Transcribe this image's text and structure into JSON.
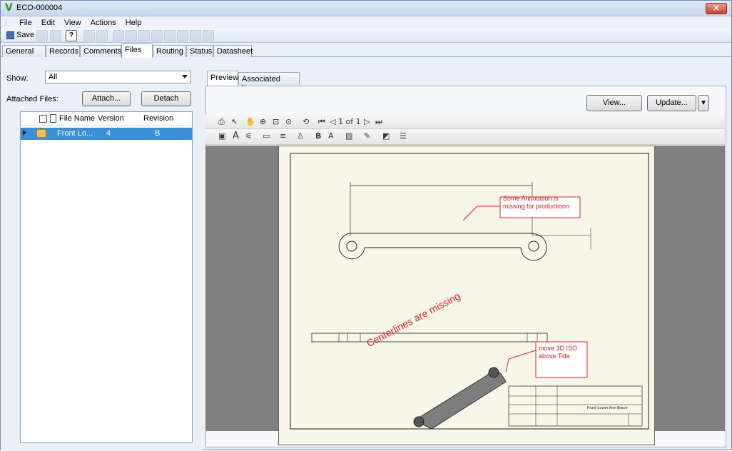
{
  "window": {
    "title": "ECO-000004",
    "close_label": "✕"
  },
  "menu": [
    "File",
    "Edit",
    "View",
    "Actions",
    "Help"
  ],
  "toolbar": {
    "save_label": "Save",
    "help_glyph": "?"
  },
  "tabs": [
    "General",
    "Records",
    "Comments",
    "Files",
    "Routing",
    "Status",
    "Datasheet"
  ],
  "files_panel": {
    "show_label": "Show:",
    "show_value": "All",
    "attached_label": "Attached Files:",
    "attach_button": "Attach...",
    "detach_button": "Detach",
    "columns": [
      "File Name",
      "Version",
      "Revision"
    ],
    "rows": [
      {
        "file_name": "Front Lo...",
        "version": "4",
        "revision": "B"
      }
    ]
  },
  "preview": {
    "tabs": [
      "Preview",
      "Associated Items"
    ],
    "view_button": "View...",
    "update_button": "Update...",
    "page_indicator": "1 of 1",
    "annotations": {
      "callout1": [
        "Some Annotation is",
        "missing for productioon"
      ],
      "diag_text": "Centerlines are missing",
      "callout2": [
        "move 3D ISO",
        "above Title"
      ]
    },
    "title_block_text": "Front Lower Arm Brace"
  },
  "colors": {
    "accent": "#3a8fdb",
    "annotation": "#ff0000",
    "sheet": "#f7f6e8",
    "viewer_bg": "#808080"
  }
}
